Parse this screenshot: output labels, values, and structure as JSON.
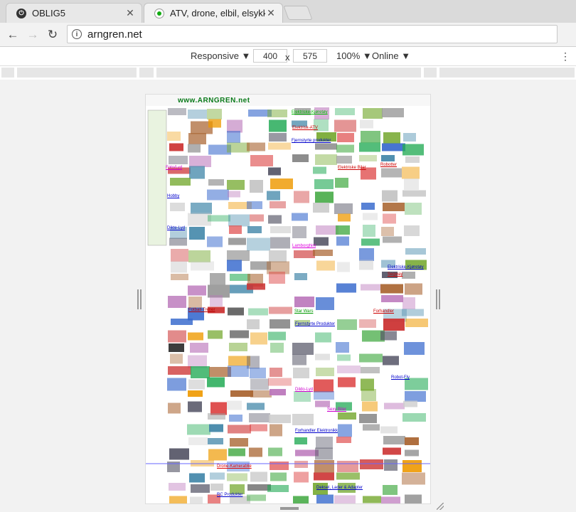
{
  "browser": {
    "tabs": [
      {
        "title": "OBLIG5",
        "active": false
      },
      {
        "title": "ATV, drone, elbil, elsykke",
        "active": true
      }
    ],
    "url": "arngren.net"
  },
  "devtools": {
    "device": "Responsive",
    "width": "400",
    "height": "575",
    "separator": "x",
    "zoom": "100%",
    "network": "Online"
  },
  "site": {
    "logo": "www.ARNGREN.net",
    "links": [
      "Elektriske-Kjøretøy",
      "Elektrisk-ATV",
      "Fjernstyrte produkter",
      "Elektriske Biler",
      "Robotter",
      "Foto/Lyd",
      "Hobby",
      "Star Wars",
      "Fjernstyrte Produkter",
      "Forhandler",
      "Elektriske-Kjøretøy",
      "Dildo-Lyd",
      "Robot-Fly",
      "Lamborghini",
      "Sexy Biler",
      "Dikte-Lyd",
      "Fotball-Trener",
      "Segway",
      "Drone-Kamerablie",
      "RC Produkter",
      "Forhandler Elektronikk",
      "Deksel, Lader & Adapter"
    ]
  }
}
